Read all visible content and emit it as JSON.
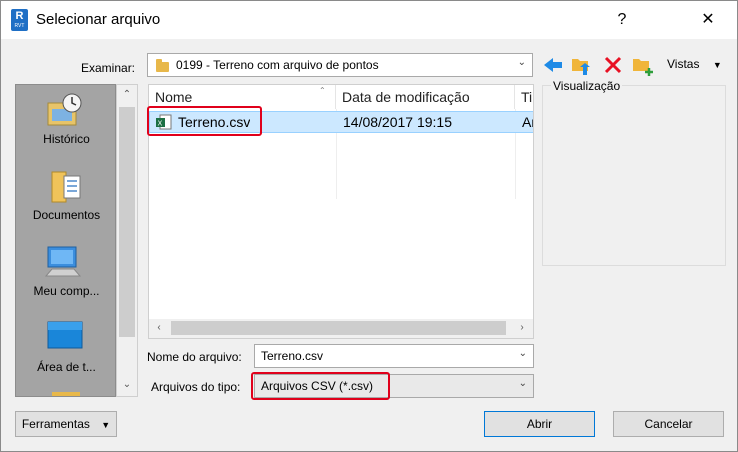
{
  "window": {
    "title": "Selecionar arquivo",
    "app_icon_letter": "R",
    "app_icon_sub": "RVT",
    "help_glyph": "?",
    "close_glyph": "✕"
  },
  "look_in": {
    "label": "Examinar:",
    "value": "0199 - Terreno com arquivo de pontos"
  },
  "toolbar": {
    "views_label": "Vistas"
  },
  "preview": {
    "label": "Visualização"
  },
  "places": [
    {
      "label": "Histórico",
      "icon": "history-icon"
    },
    {
      "label": "Documentos",
      "icon": "documents-icon"
    },
    {
      "label": "Meu comp...",
      "icon": "computer-icon"
    },
    {
      "label": "Área de t...",
      "icon": "desktop-icon"
    }
  ],
  "file_list": {
    "columns": [
      "Nome",
      "Data de modificação",
      "Ti"
    ],
    "rows": [
      {
        "name": "Terreno.csv",
        "modified": "14/08/2017 19:15",
        "type": "Ar"
      }
    ]
  },
  "file_name": {
    "label": "Nome do arquivo:",
    "value": "Terreno.csv"
  },
  "file_type": {
    "label": "Arquivos do tipo:",
    "value": "Arquivos CSV (*.csv)"
  },
  "buttons": {
    "tools": "Ferramentas",
    "open": "Abrir",
    "cancel": "Cancelar"
  },
  "colors": {
    "selection": "#cce8ff",
    "highlight": "#e0001b",
    "accent": "#0078d7"
  }
}
